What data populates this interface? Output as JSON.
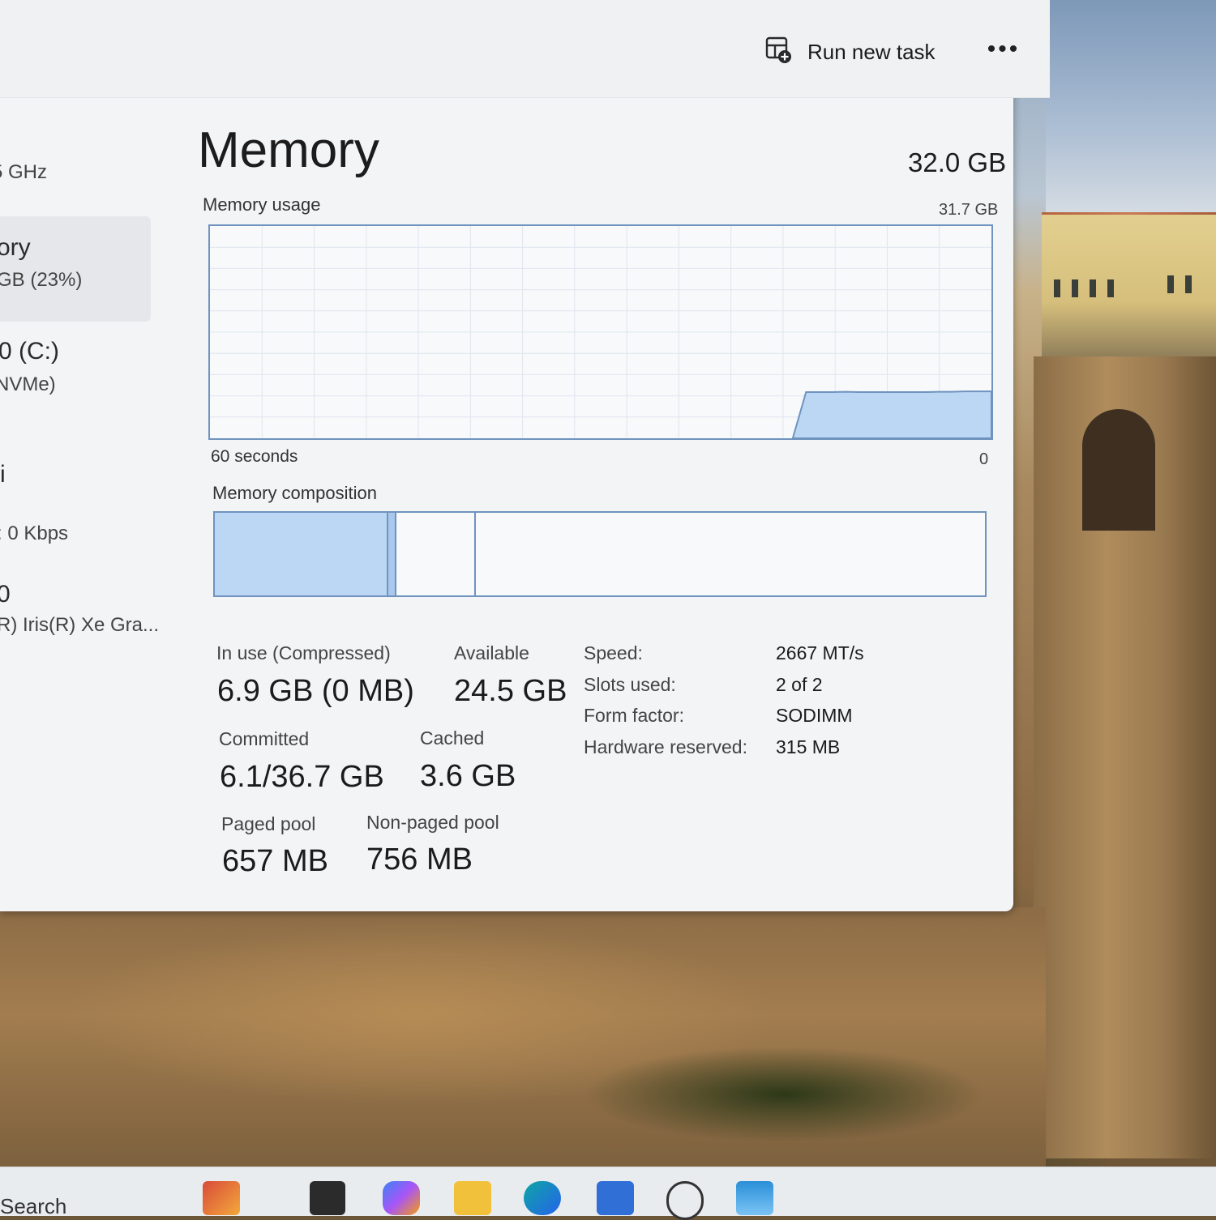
{
  "toolbar": {
    "run_new_task_label": "Run new task",
    "more_label": "•••"
  },
  "sidebar": {
    "items": [
      {
        "title": "",
        "subtitle": "5 GHz"
      },
      {
        "title": "ory",
        "subtitle": "GB (23%)"
      },
      {
        "title": "0 (C:)",
        "subtitle": "NVMe)"
      },
      {
        "title": "i",
        "subtitle": ": 0 Kbps"
      },
      {
        "title": "0",
        "subtitle": "R) Iris(R) Xe Gra..."
      }
    ]
  },
  "memory": {
    "title": "Memory",
    "total": "32.0 GB",
    "usage_label": "Memory usage",
    "usage_max": "31.7 GB",
    "axis_left": "60 seconds",
    "axis_right": "0",
    "composition_label": "Memory composition",
    "usage_history": [
      0,
      0,
      0,
      0,
      0,
      0,
      0,
      0,
      0,
      0,
      0,
      0,
      0,
      0,
      0,
      0,
      0,
      0,
      0,
      0,
      0,
      0,
      0,
      0,
      0,
      0,
      0,
      0,
      0,
      0,
      0,
      0,
      0,
      0,
      0,
      0,
      0,
      0,
      0,
      0,
      0,
      0,
      0,
      0,
      0,
      6.9,
      6.9,
      6.9,
      6.95,
      6.9,
      6.9,
      6.9,
      6.9,
      6.9,
      6.9,
      6.95,
      6.95,
      7.0,
      7.0,
      7.0
    ],
    "usage_scale_max": 31.7,
    "composition": {
      "in_use_fraction": 0.225,
      "modified_fraction": 0.011,
      "standby_fraction": 0.103
    }
  },
  "stats": {
    "in_use_label": "In use (Compressed)",
    "in_use_value": "6.9 GB (0 MB)",
    "available_label": "Available",
    "available_value": "24.5 GB",
    "committed_label": "Committed",
    "committed_value": "6.1/36.7 GB",
    "cached_label": "Cached",
    "cached_value": "3.6 GB",
    "paged_label": "Paged pool",
    "paged_value": "657 MB",
    "nonpaged_label": "Non-paged pool",
    "nonpaged_value": "756 MB"
  },
  "details": {
    "speed_label": "Speed:",
    "speed_value": "2667 MT/s",
    "slots_label": "Slots used:",
    "slots_value": "2 of 2",
    "form_label": "Form factor:",
    "form_value": "SODIMM",
    "reserved_label": "Hardware reserved:",
    "reserved_value": "315 MB"
  },
  "taskbar": {
    "search_label": "Search",
    "icons": [
      "widgets-icon",
      "app-icon",
      "copilot-icon",
      "file-explorer-icon",
      "edge-icon",
      "store-icon",
      "dell-icon",
      "monitor-app-icon"
    ]
  },
  "colors": {
    "graph_fill": "#bcd7f4",
    "graph_line": "#6f93be",
    "grid": "#dfe6ee"
  }
}
